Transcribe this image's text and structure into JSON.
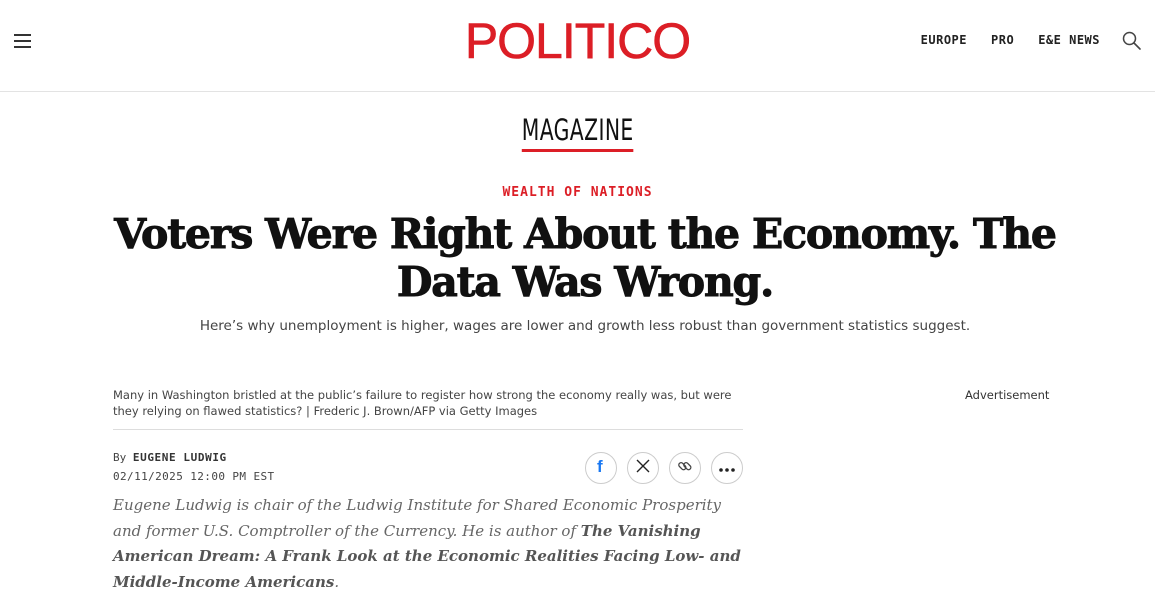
{
  "header": {
    "logo": "POLITICO",
    "nav": [
      "EUROPE",
      "PRO",
      "E&E NEWS"
    ]
  },
  "section": "MAGAZINE",
  "article": {
    "kicker": "WEALTH OF NATIONS",
    "headline": "Voters Were Right About the Economy. The Data Was Wrong.",
    "dek": "Here’s why unemployment is higher, wages are lower and growth less robust than government statistics suggest.",
    "caption": "Many in Washington bristled at the public’s failure to register how strong the economy really was, but were they relying on flawed statistics? | Frederic J. Brown/AFP via Getty Images",
    "byline_prefix": "By",
    "author": "EUGENE LUDWIG",
    "date": "02/11/2025 12:00 PM EST",
    "bio_text_1": "Eugene Ludwig is chair of the Ludwig Institute for Shared Economic Prosperity and former U.S. Comptroller of the Currency. He is author of ",
    "bio_book": "The Vanishing American Dream: A Frank Look at the Economic Realities Facing Low- and Middle-Income Americans",
    "bio_text_2": "."
  },
  "sidebar": {
    "ad_label": "Advertisement"
  },
  "colors": {
    "brand_red": "#dc1e26",
    "facebook_blue": "#1877f2"
  },
  "icons": [
    "menu-icon",
    "search-icon",
    "facebook-icon",
    "x-icon",
    "link-icon",
    "more-icon"
  ]
}
